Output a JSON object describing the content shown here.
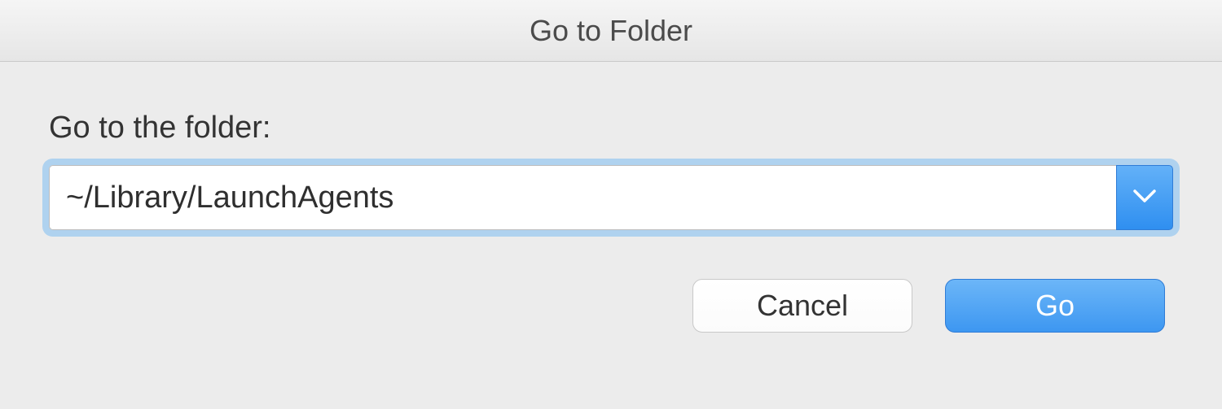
{
  "dialog": {
    "title": "Go to Folder",
    "label": "Go to the folder:",
    "pathValue": "~/Library/LaunchAgents",
    "cancelLabel": "Cancel",
    "goLabel": "Go"
  }
}
